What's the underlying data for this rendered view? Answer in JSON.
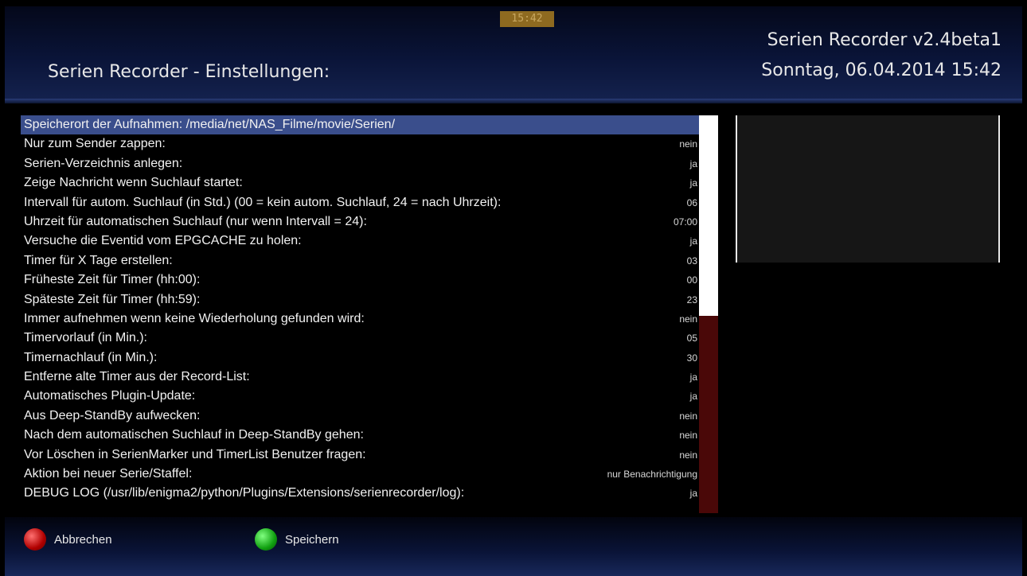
{
  "header": {
    "clock": "15:42",
    "title": "Serien Recorder - Einstellungen:",
    "plugin_version": "Serien Recorder v2.4beta1",
    "datetime": "Sonntag, 06.04.2014  15:42"
  },
  "settings": [
    {
      "label": "Speicherort der Aufnahmen:   /media/net/NAS_Filme/movie/Serien/",
      "value": ""
    },
    {
      "label": "Nur zum Sender zappen:",
      "value": "nein"
    },
    {
      "label": "Serien-Verzeichnis anlegen:",
      "value": "ja"
    },
    {
      "label": "Zeige Nachricht wenn Suchlauf startet:",
      "value": "ja"
    },
    {
      "label": "Intervall für autom. Suchlauf (in Std.) (00 = kein autom. Suchlauf, 24 = nach Uhrzeit):",
      "value": "06"
    },
    {
      "label": "Uhrzeit für automatischen Suchlauf (nur wenn Intervall = 24):",
      "value": "07:00"
    },
    {
      "label": "Versuche die Eventid vom EPGCACHE zu holen:",
      "value": "ja"
    },
    {
      "label": "Timer für X Tage erstellen:",
      "value": "03"
    },
    {
      "label": "Früheste Zeit für Timer (hh:00):",
      "value": "00"
    },
    {
      "label": "Späteste Zeit für Timer (hh:59):",
      "value": "23"
    },
    {
      "label": "Immer aufnehmen wenn keine Wiederholung gefunden wird:",
      "value": "nein"
    },
    {
      "label": "Timervorlauf (in Min.):",
      "value": "05"
    },
    {
      "label": "Timernachlauf (in Min.):",
      "value": "30"
    },
    {
      "label": "Entferne alte Timer aus der Record-List:",
      "value": "ja"
    },
    {
      "label": "Automatisches Plugin-Update:",
      "value": "ja"
    },
    {
      "label": "Aus Deep-StandBy aufwecken:",
      "value": "nein"
    },
    {
      "label": "Nach dem automatischen Suchlauf in Deep-StandBy gehen:",
      "value": "nein"
    },
    {
      "label": "Vor Löschen in SerienMarker und TimerList Benutzer fragen:",
      "value": "nein"
    },
    {
      "label": "Aktion bei neuer Serie/Staffel:",
      "value": "nur Benachrichtigung"
    },
    {
      "label": "DEBUG LOG (/usr/lib/enigma2/python/Plugins/Extensions/serienrecorder/log):",
      "value": "ja"
    }
  ],
  "footer": {
    "red_label": "Abbrechen",
    "green_label": "Speichern"
  },
  "colors": {
    "selection": "#3a4e8c",
    "scrollbar_track": "#4a0808",
    "red_key": "#c00000",
    "green_key": "#10a010"
  }
}
